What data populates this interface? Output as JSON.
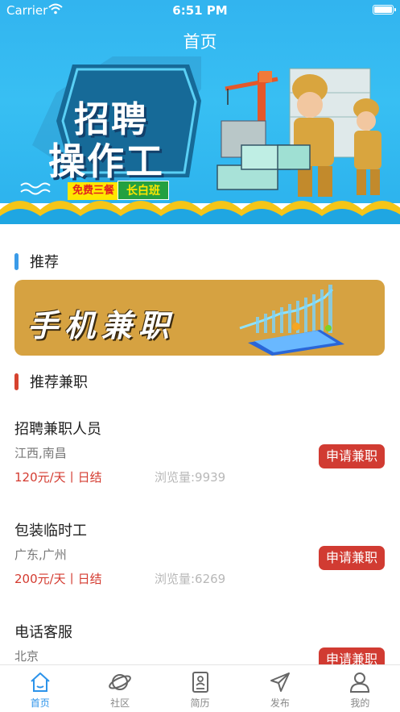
{
  "status_bar": {
    "carrier": "Carrier",
    "time": "6:51 PM"
  },
  "nav": {
    "title": "首页"
  },
  "banner": {
    "line1": "招聘",
    "line2": "操作工",
    "tag1": "免费三餐",
    "tag2": "长白班"
  },
  "sections": {
    "recommend": "推荐",
    "recommend_parttime": "推荐兼职"
  },
  "promo": {
    "text": "手机兼职"
  },
  "jobs": [
    {
      "title": "招聘兼职人员",
      "location": "江西,南昌",
      "salary": "120元/天丨日结",
      "views": "浏览量:9939",
      "button": "申请兼职"
    },
    {
      "title": "包装临时工",
      "location": "广东,广州",
      "salary": "200元/天丨日结",
      "views": "浏览量:6269",
      "button": "申请兼职"
    },
    {
      "title": "电话客服",
      "location": "北京",
      "salary": "",
      "views": "",
      "button": "申请兼职"
    }
  ],
  "tabs": [
    {
      "label": "首页",
      "icon": "home-icon",
      "active": true
    },
    {
      "label": "社区",
      "icon": "planet-icon",
      "active": false
    },
    {
      "label": "简历",
      "icon": "resume-icon",
      "active": false
    },
    {
      "label": "发布",
      "icon": "send-icon",
      "active": false
    },
    {
      "label": "我的",
      "icon": "user-icon",
      "active": false
    }
  ],
  "colors": {
    "accent": "#2c93ea",
    "apply": "#d13b32",
    "banner": "#38bff3",
    "promo": "#d6a241"
  }
}
